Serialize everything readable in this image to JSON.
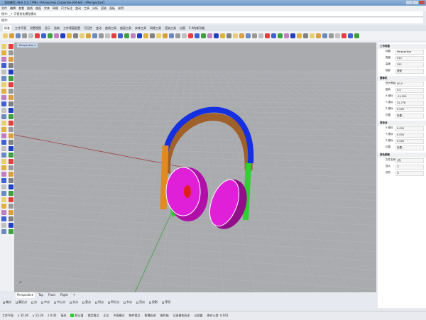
{
  "window": {
    "title": "耳机模型.3dm (13.7 MB) - Rhinoceros Corporate (64-bit) - [Perspective]"
  },
  "menu": [
    "文件",
    "编辑",
    "查看",
    "曲线",
    "曲面",
    "实体",
    "网格",
    "尺寸标注",
    "变动",
    "工具",
    "分析",
    "渲染",
    "面板",
    "说明"
  ],
  "command": {
    "history": "指令: _↑ 可视觉化模型模式",
    "prompt": "指令:"
  },
  "tabs": [
    "标准",
    "工作平面",
    "设置视图",
    "显示",
    "选取",
    "工作视窗配置",
    "可见性",
    "变动",
    "曲线工具",
    "曲面工具",
    "实体工具",
    "网格工具",
    "渲染工具",
    "出图",
    "5.0的新功能"
  ],
  "viewport": {
    "label": "Perspective ▾",
    "tabs": [
      "Perspective",
      "Top",
      "Front",
      "Right",
      "+"
    ]
  },
  "panel": {
    "section_viewport": "工作视窗",
    "viewport_rows": [
      {
        "k": "标题",
        "v": "Perspective"
      },
      {
        "k": "宽度",
        "v": "510"
      },
      {
        "k": "高度",
        "v": "352"
      },
      {
        "k": "投影",
        "v": "透视"
      }
    ],
    "section_camera": "摄像机",
    "camera_rows": [
      {
        "k": "镜头焦距",
        "v": "50.0"
      },
      {
        "k": "旋转",
        "v": "0.0"
      },
      {
        "k": "X 座标",
        "v": "-19.559"
      },
      {
        "k": "Y 座标",
        "v": "22.778"
      },
      {
        "k": "Z 座标",
        "v": "0.000"
      },
      {
        "k": "位置",
        "v": "设置..."
      }
    ],
    "section_target": "目标点",
    "target_rows": [
      {
        "k": "X 座标",
        "v": "0.000"
      },
      {
        "k": "Y 座标",
        "v": "0.000"
      },
      {
        "k": "Z 座标",
        "v": "0.000"
      },
      {
        "k": "位置",
        "v": "设置..."
      }
    ],
    "section_wallpaper": "底色图案",
    "wallpaper_rows": [
      {
        "k": "文件名称",
        "v": "(无)"
      },
      {
        "k": "显示",
        "v": "☐"
      },
      {
        "k": "灰阶",
        "v": "☑"
      }
    ]
  },
  "osnap": [
    "端点",
    "最近点",
    "点",
    "中点",
    "中心点",
    "交点",
    "垂点",
    "切点",
    "四分点",
    "节点",
    "顶点",
    "投影",
    "停用"
  ],
  "status": {
    "cplane": "工作平面",
    "x": "x 35.00",
    "y": "y 13.30",
    "z": "z 0.00",
    "unit": "毫米",
    "layer": "默认值",
    "items": [
      "锁定格点",
      "正交",
      "平面模式",
      "物件锁点",
      "智慧轨迹",
      "操作轴",
      "记录建构历史",
      "过滤器",
      "绝对公差: 0.001"
    ]
  },
  "colors": {
    "band_top": "#1530e0",
    "band_inner": "#a0602a",
    "band_side": "#e08a20",
    "earcup": "#e020d8",
    "cable": "#30d030",
    "grid": "#b8babe",
    "x_axis": "#a04040",
    "y_axis": "#40a040"
  }
}
